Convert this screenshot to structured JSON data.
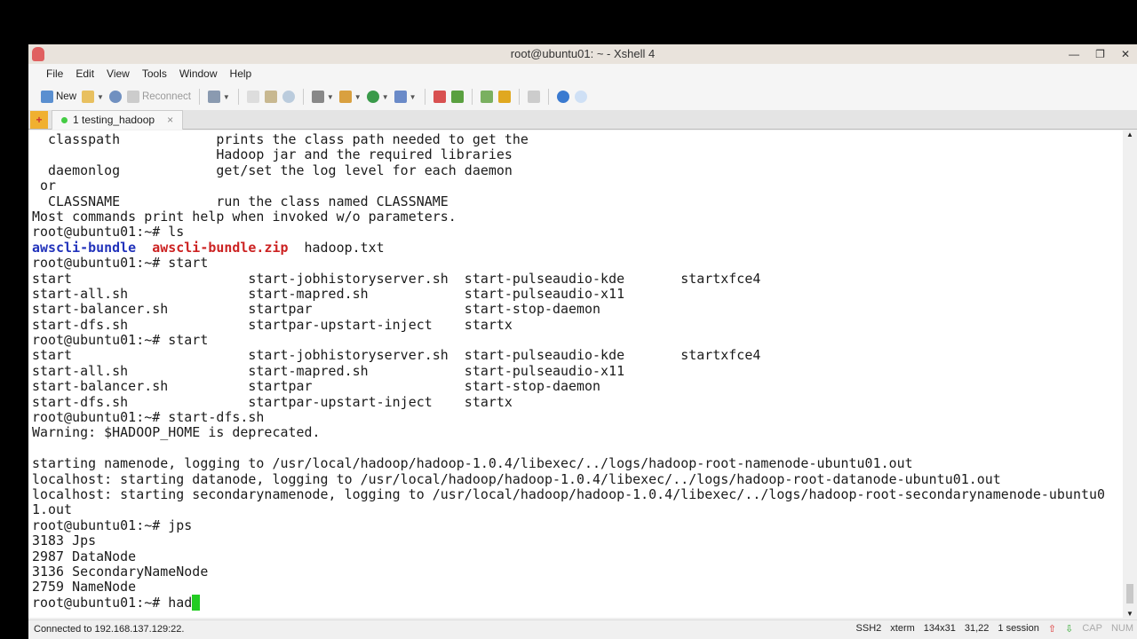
{
  "window": {
    "title": "root@ubuntu01: ~ - Xshell 4"
  },
  "menu": [
    "File",
    "Edit",
    "View",
    "Tools",
    "Window",
    "Help"
  ],
  "toolbar": {
    "new": "New",
    "reconnect": "Reconnect"
  },
  "tab": {
    "label": "1 testing_hadoop",
    "close": "×"
  },
  "terminal": {
    "lines": [
      [
        [
          "  classpath            prints the class path needed to get the",
          ""
        ]
      ],
      [
        [
          "                       Hadoop jar and the required libraries",
          ""
        ]
      ],
      [
        [
          "  daemonlog            get/set the log level for each daemon",
          ""
        ]
      ],
      [
        [
          " or",
          ""
        ]
      ],
      [
        [
          "  CLASSNAME            run the class named CLASSNAME",
          ""
        ]
      ],
      [
        [
          "Most commands print help when invoked w/o parameters.",
          ""
        ]
      ],
      [
        [
          "root@ubuntu01:~# ls",
          ""
        ]
      ],
      [
        [
          "awscli-bundle",
          "blue"
        ],
        [
          "  ",
          ""
        ],
        [
          "awscli-bundle.zip",
          "red"
        ],
        [
          "  hadoop.txt",
          ""
        ]
      ],
      [
        [
          "root@ubuntu01:~# start",
          ""
        ]
      ],
      [
        [
          "start                      start-jobhistoryserver.sh  start-pulseaudio-kde       startxfce4",
          ""
        ]
      ],
      [
        [
          "start-all.sh               start-mapred.sh            start-pulseaudio-x11",
          ""
        ]
      ],
      [
        [
          "start-balancer.sh          startpar                   start-stop-daemon",
          ""
        ]
      ],
      [
        [
          "start-dfs.sh               startpar-upstart-inject    startx",
          ""
        ]
      ],
      [
        [
          "root@ubuntu01:~# start",
          ""
        ]
      ],
      [
        [
          "start                      start-jobhistoryserver.sh  start-pulseaudio-kde       startxfce4",
          ""
        ]
      ],
      [
        [
          "start-all.sh               start-mapred.sh            start-pulseaudio-x11",
          ""
        ]
      ],
      [
        [
          "start-balancer.sh          startpar                   start-stop-daemon",
          ""
        ]
      ],
      [
        [
          "start-dfs.sh               startpar-upstart-inject    startx",
          ""
        ]
      ],
      [
        [
          "root@ubuntu01:~# start-dfs.sh",
          ""
        ]
      ],
      [
        [
          "Warning: $HADOOP_HOME is deprecated.",
          ""
        ]
      ],
      [
        [
          "",
          ""
        ]
      ],
      [
        [
          "starting namenode, logging to /usr/local/hadoop/hadoop-1.0.4/libexec/../logs/hadoop-root-namenode-ubuntu01.out",
          ""
        ]
      ],
      [
        [
          "localhost: starting datanode, logging to /usr/local/hadoop/hadoop-1.0.4/libexec/../logs/hadoop-root-datanode-ubuntu01.out",
          ""
        ]
      ],
      [
        [
          "localhost: starting secondarynamenode, logging to /usr/local/hadoop/hadoop-1.0.4/libexec/../logs/hadoop-root-secondarynamenode-ubuntu0",
          ""
        ]
      ],
      [
        [
          "1.out",
          ""
        ]
      ],
      [
        [
          "root@ubuntu01:~# jps",
          ""
        ]
      ],
      [
        [
          "3183 Jps",
          ""
        ]
      ],
      [
        [
          "2987 DataNode",
          ""
        ]
      ],
      [
        [
          "3136 SecondaryNameNode",
          ""
        ]
      ],
      [
        [
          "2759 NameNode",
          ""
        ]
      ],
      [
        [
          "root@ubuntu01:~# had",
          ""
        ],
        [
          " ",
          "cursor"
        ]
      ]
    ]
  },
  "status": {
    "connection": "Connected to 192.168.137.129:22.",
    "protocol": "SSH2",
    "term": "xterm",
    "size": "134x31",
    "pos": "31,22",
    "sessions": "1 session",
    "cap": "CAP",
    "num": "NUM"
  }
}
